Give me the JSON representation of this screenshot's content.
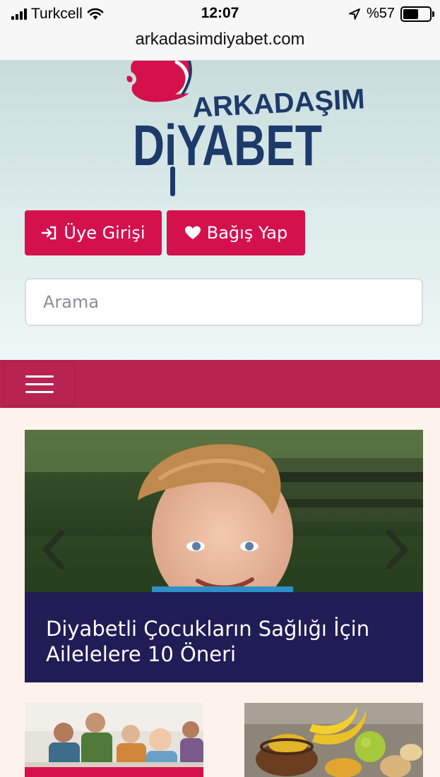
{
  "status_bar": {
    "carrier": "Turkcell",
    "time": "12:07",
    "battery": "%57",
    "battery_level": 0.57
  },
  "browser": {
    "url": "arkadasimdiyabet.com"
  },
  "header": {
    "logo_top": "ARKADAŞIM",
    "logo_bottom": "DiYABET",
    "login_label": "Üye Girişi",
    "donate_label": "Bağış Yap",
    "search_placeholder": "Arama"
  },
  "carousel": {
    "caption_line1": "Diyabetli Çocukların Sağlığı İçin",
    "caption_line2": "Ailelelere 10 Öneri"
  },
  "colors": {
    "brand_red": "#d4114d",
    "nav_bar": "#b8244f",
    "caption_bg": "#201c55",
    "logo_blue": "#1c3a6a"
  }
}
